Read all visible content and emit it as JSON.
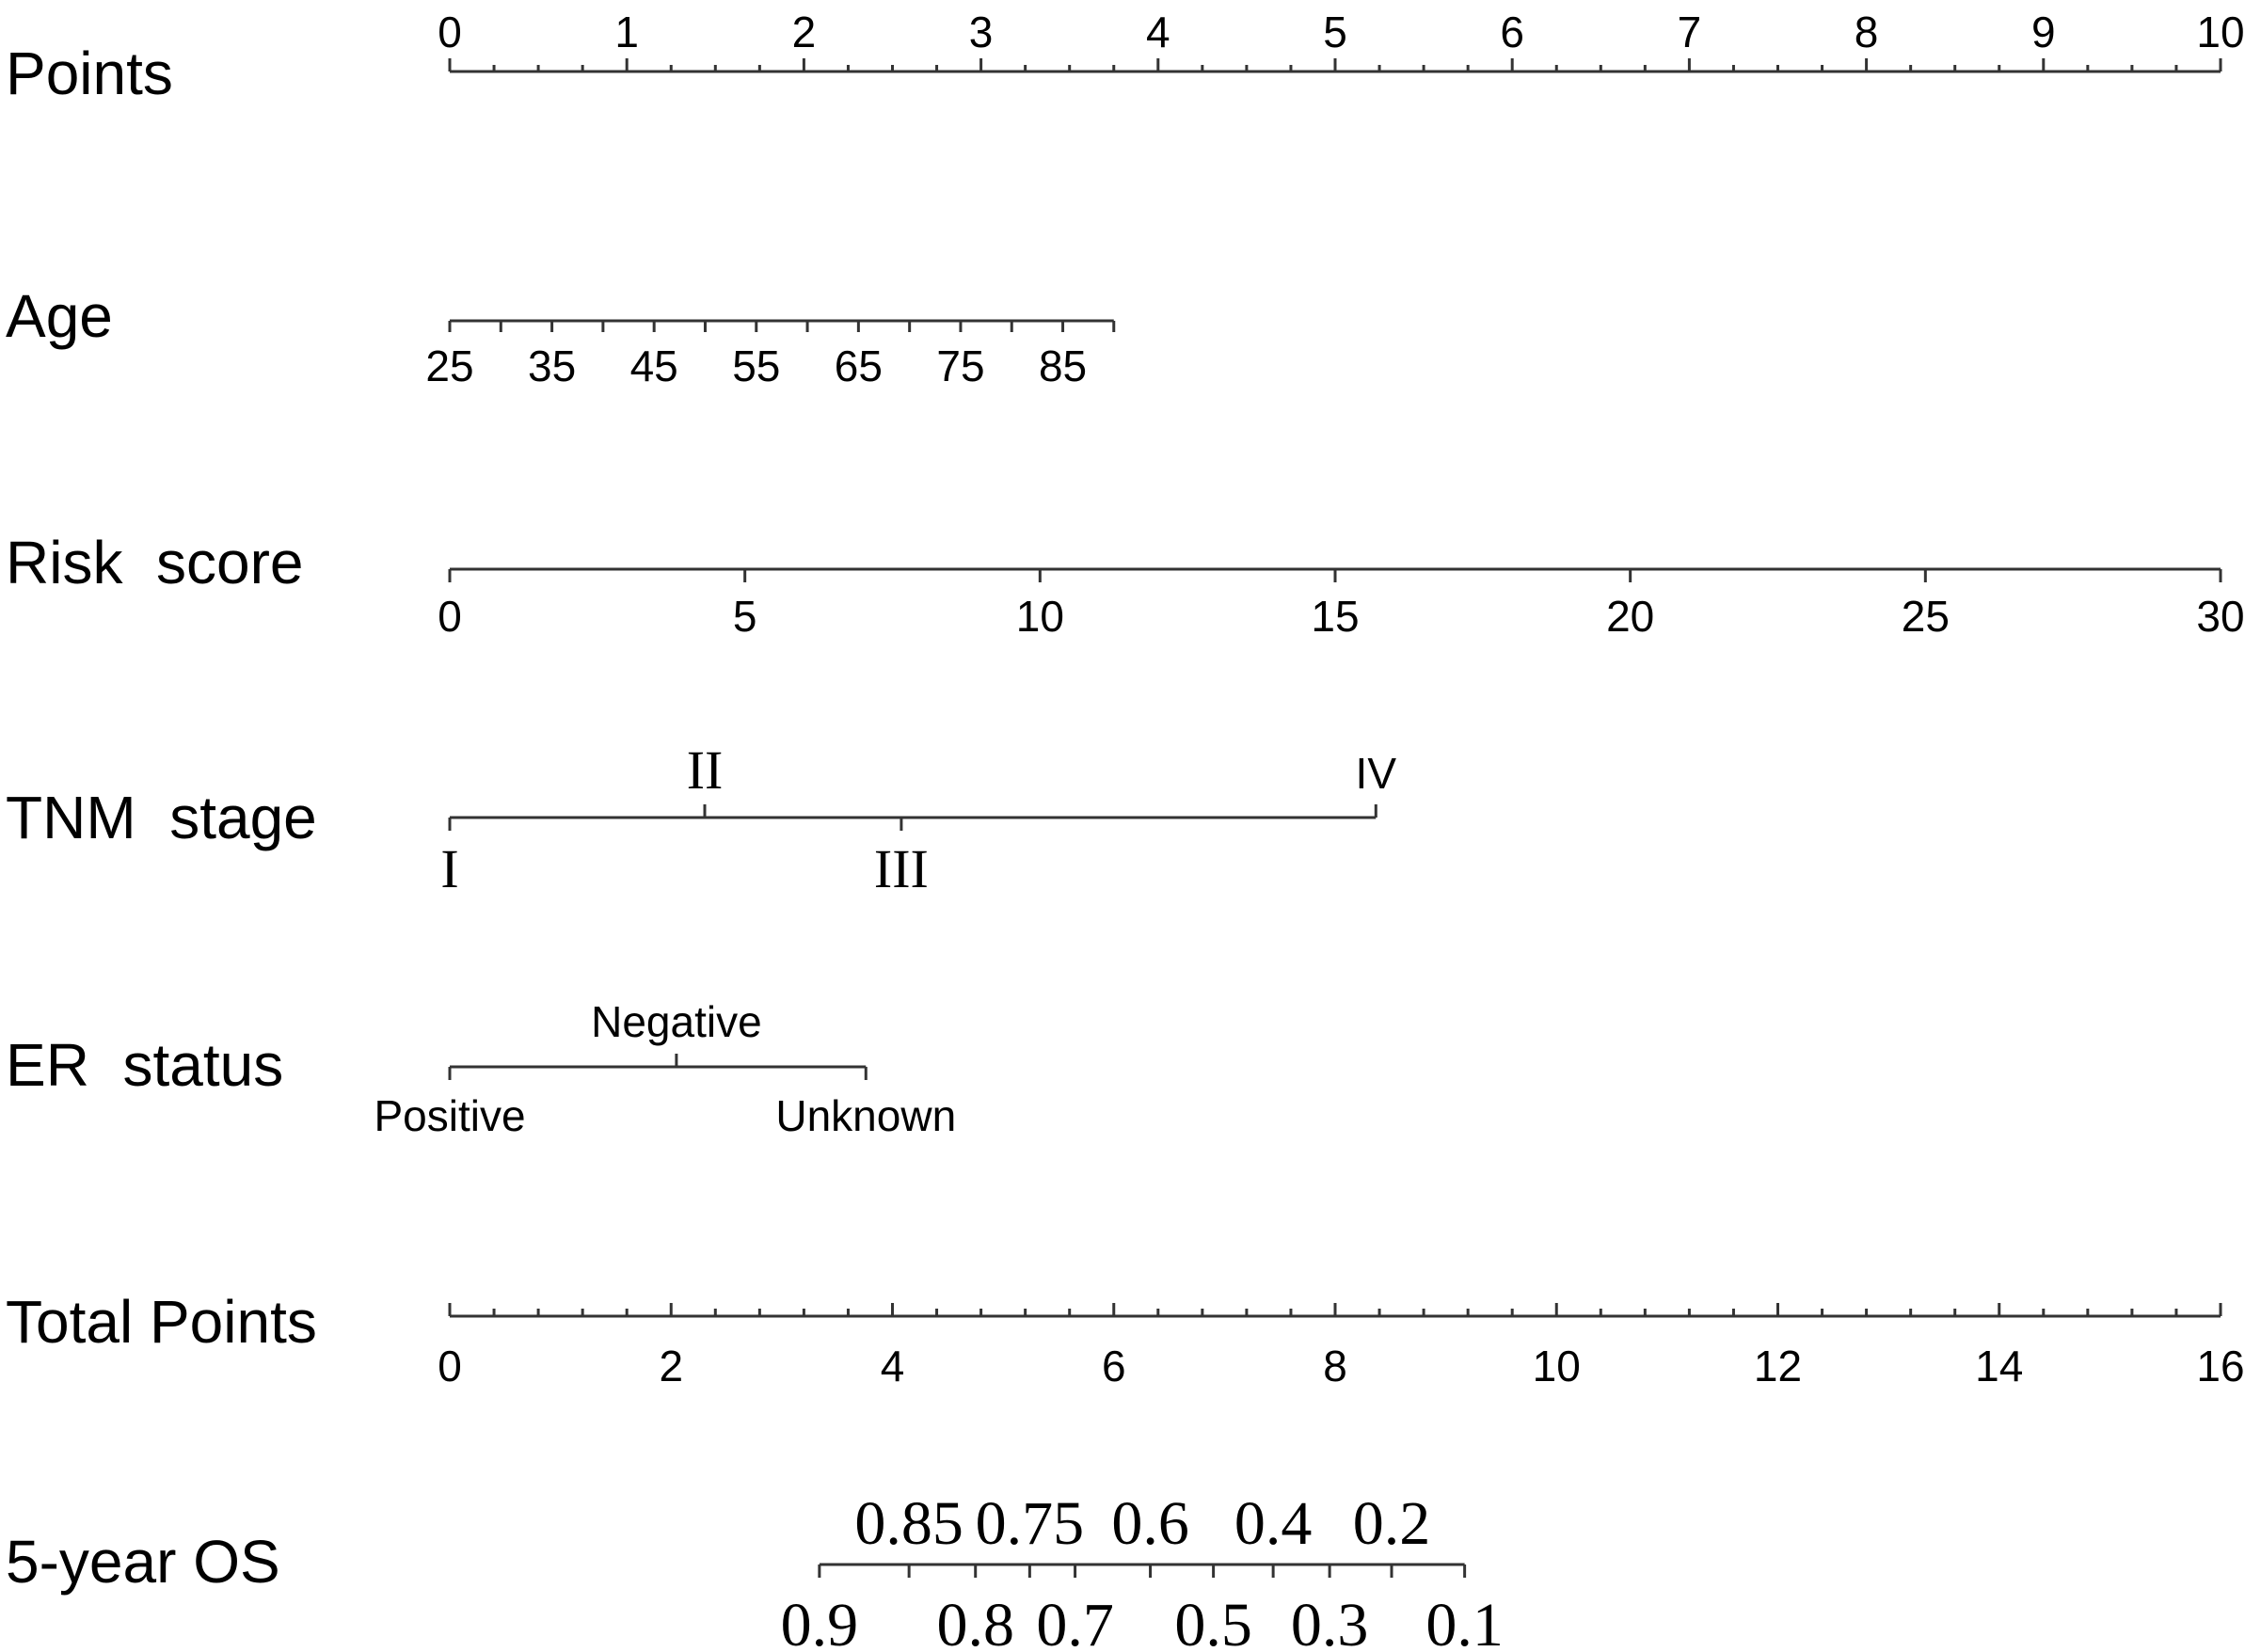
{
  "chart_data": {
    "type": "nomogram",
    "title": "",
    "points_range": [
      0,
      10
    ],
    "rows": [
      {
        "name": "Points",
        "label": "Points",
        "kind": "points-scale",
        "ticks": [
          0,
          1,
          2,
          3,
          4,
          5,
          6,
          7,
          8,
          9,
          10
        ],
        "tick_labels": [
          "0",
          "1",
          "2",
          "3",
          "4",
          "5",
          "6",
          "7",
          "8",
          "9",
          "10"
        ],
        "minor_step": 0.25
      },
      {
        "name": "Age",
        "label": "Age",
        "kind": "continuous",
        "values": [
          25,
          30,
          35,
          40,
          45,
          50,
          55,
          60,
          65,
          70,
          75,
          80,
          85,
          90
        ],
        "points": [
          0,
          0.2885,
          0.577,
          0.8655,
          1.154,
          1.4425,
          1.731,
          2.0195,
          2.308,
          2.5965,
          2.885,
          3.1735,
          3.462,
          3.75
        ],
        "tick_labels": [
          "25",
          "35",
          "45",
          "55",
          "65",
          "75",
          "85"
        ],
        "labelled_values": [
          25,
          35,
          45,
          55,
          65,
          75,
          85
        ]
      },
      {
        "name": "Risk score",
        "label": "Risk  score",
        "kind": "continuous",
        "values": [
          0,
          5,
          10,
          15,
          20,
          25,
          30
        ],
        "points": [
          0,
          1.6667,
          3.3333,
          5,
          6.6667,
          8.3333,
          10
        ],
        "tick_labels": [
          "0",
          "5",
          "10",
          "15",
          "20",
          "25",
          "30"
        ]
      },
      {
        "name": "TNM stage",
        "label": "TNM  stage",
        "kind": "categorical",
        "categories": [
          "I",
          "II",
          "III",
          "IV"
        ],
        "points": [
          0,
          1.44,
          2.55,
          5.23
        ],
        "label_side": [
          "below",
          "above",
          "below",
          "above"
        ]
      },
      {
        "name": "ER status",
        "label": "ER  status",
        "kind": "categorical",
        "categories": [
          "Positive",
          "Negative",
          "Unknown"
        ],
        "points": [
          0,
          1.28,
          2.35
        ],
        "label_side": [
          "below",
          "above",
          "below"
        ]
      }
    ],
    "total_points": {
      "label": "Total Points",
      "range": [
        0,
        16
      ],
      "ticks": [
        0,
        2,
        4,
        6,
        8,
        10,
        12,
        14,
        16
      ],
      "tick_labels": [
        "0",
        "2",
        "4",
        "6",
        "8",
        "10",
        "12",
        "14",
        "16"
      ],
      "minor_step": 0.4
    },
    "outcome": {
      "label": "5-year OS",
      "values": [
        0.9,
        0.85,
        0.8,
        0.75,
        0.7,
        0.6,
        0.5,
        0.4,
        0.3,
        0.2,
        0.1
      ],
      "tick_labels": [
        "0.9",
        "0.85",
        "0.8",
        "0.75",
        "0.7",
        "0.6",
        "0.5",
        "0.4",
        "0.3",
        "0.2",
        "0.1"
      ],
      "total_points": [
        3.34,
        4.15,
        4.75,
        5.24,
        5.65,
        6.33,
        6.9,
        7.44,
        7.95,
        8.51,
        9.17
      ],
      "label_side": [
        "below",
        "above",
        "below",
        "above",
        "below",
        "above",
        "below",
        "above",
        "below",
        "above",
        "below"
      ]
    }
  }
}
